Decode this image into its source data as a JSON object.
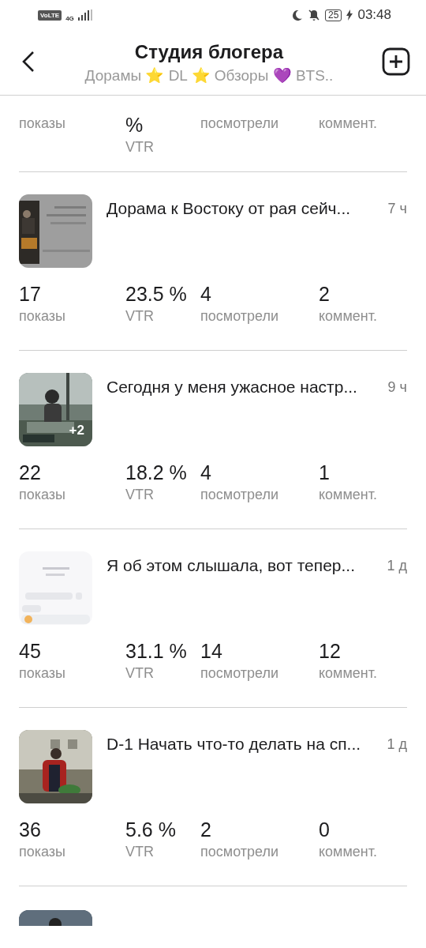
{
  "status_bar": {
    "network": "VoLTE",
    "network_type": "4G",
    "battery": "25",
    "time": "03:48"
  },
  "header": {
    "title": "Студия блогера",
    "subtitle": "Дорамы ⭐ DL ⭐ Обзоры 💜 BTS.."
  },
  "posts": [
    {
      "kind": "partial-top",
      "stats": [
        {
          "label": "показы"
        },
        {
          "value": "%",
          "label": "VTR"
        },
        {
          "label": "посмотрели"
        },
        {
          "label": "коммент."
        }
      ]
    },
    {
      "kind": "full",
      "title": "Дорама к Востоку от рая сейч...",
      "time": "7 ч",
      "stats": [
        {
          "value": "17",
          "label": "показы"
        },
        {
          "value": "23.5 %",
          "label": "VTR"
        },
        {
          "value": "4",
          "label": "посмотрели"
        },
        {
          "value": "2",
          "label": "коммент."
        }
      ]
    },
    {
      "kind": "full",
      "thumbnail": {
        "kind": "picture",
        "badge": "+2"
      },
      "title": "Сегодня у меня ужасное настр...",
      "time": "9 ч",
      "stats": [
        {
          "value": "22",
          "label": "показы"
        },
        {
          "value": "18.2 %",
          "label": "VTR"
        },
        {
          "value": "4",
          "label": "посмотрели"
        },
        {
          "value": "1",
          "label": "коммент."
        }
      ]
    },
    {
      "kind": "full",
      "title": "Я об этом слышала, вот тепер...",
      "time": "1 д",
      "stats": [
        {
          "value": "45",
          "label": "показы"
        },
        {
          "value": "31.1 %",
          "label": "VTR"
        },
        {
          "value": "14",
          "label": "посмотрели"
        },
        {
          "value": "12",
          "label": "коммент."
        }
      ]
    },
    {
      "kind": "full",
      "title": "D-1 Начать что-то делать на сп...",
      "time": "1 д",
      "stats": [
        {
          "value": "36",
          "label": "показы"
        },
        {
          "value": "5.6 %",
          "label": "VTR"
        },
        {
          "value": "2",
          "label": "посмотрели"
        },
        {
          "value": "0",
          "label": "коммент."
        }
      ]
    },
    {
      "kind": "partial-bottom"
    }
  ]
}
